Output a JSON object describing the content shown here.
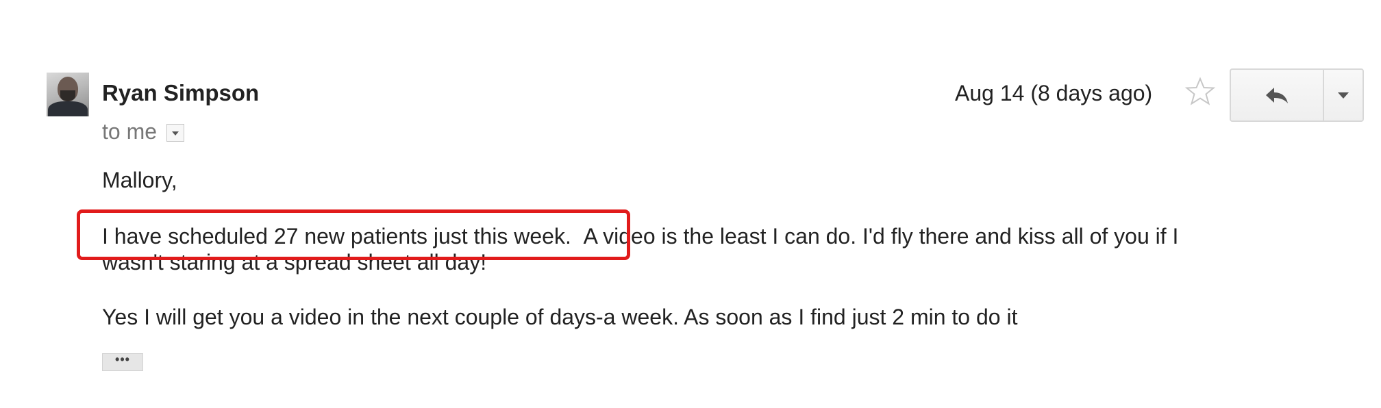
{
  "message": {
    "sender": {
      "name": "Ryan Simpson"
    },
    "recipient_label": "to me",
    "date": "Aug 14 (8 days ago)",
    "actions": {
      "reply_icon": "reply-arrow-icon",
      "more_icon": "chevron-down-icon",
      "star_icon": "star-outline-icon"
    },
    "body": {
      "greeting": "Mallory,",
      "highlighted_sentence": "I have scheduled 27 new patients just this week.",
      "line1_rest": "A video is the least I can do.  I'd fly there and kiss all of you if I",
      "line1_wrap": "wasn't staring at a spread sheet all day!",
      "line2": "Yes I will get you a video in the next couple of days-a week.  As soon as I find just 2 min to do it"
    },
    "trimmed_content_label": "•••"
  },
  "colors": {
    "highlight_border": "#e11b1b",
    "text": "#222222",
    "muted_text": "#777777"
  }
}
